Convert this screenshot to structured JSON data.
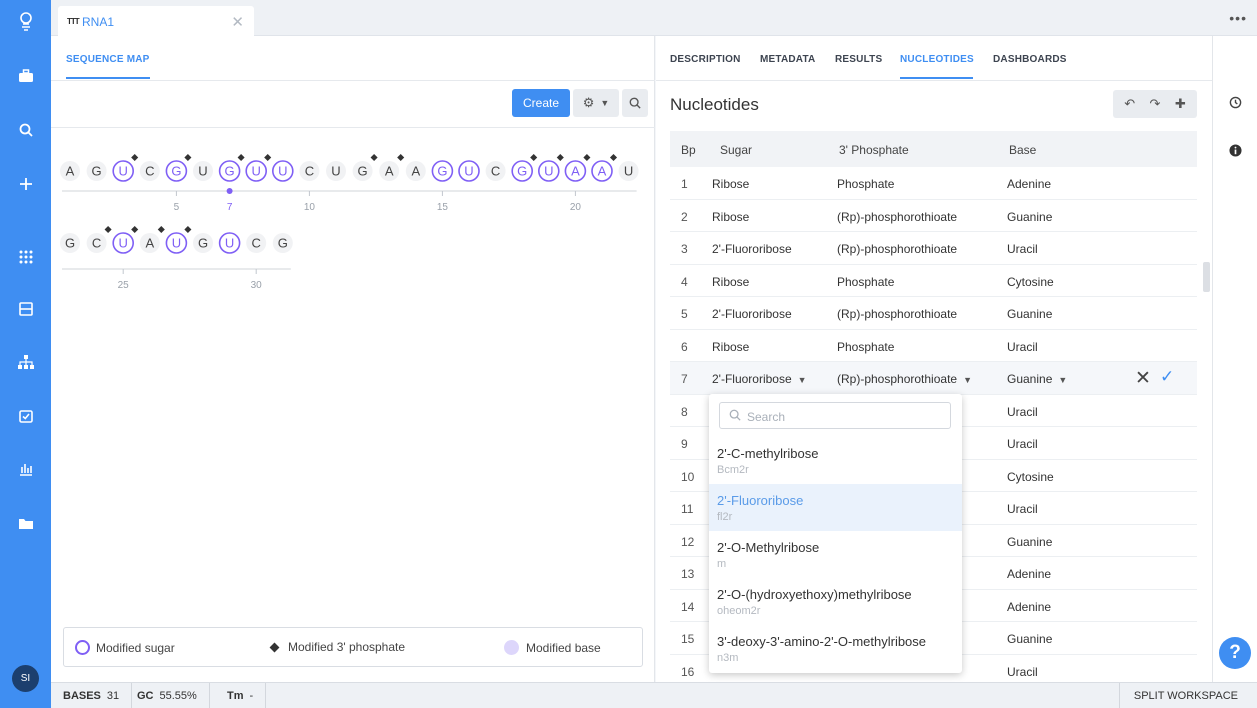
{
  "rail": {
    "avatar": "SI",
    "icons": [
      "logo-icon",
      "briefcase-icon",
      "search-icon",
      "plus-icon",
      "apps-grid-icon",
      "layout-icon",
      "hierarchy-icon",
      "task-check-icon",
      "chart-icon",
      "folder-icon"
    ]
  },
  "tab": {
    "title": "RNA1",
    "type_icon": "TTT"
  },
  "left": {
    "subnav_title": "SEQUENCE MAP",
    "create_label": "Create"
  },
  "sequence": {
    "line1": [
      "A",
      "G",
      "U",
      "C",
      "G",
      "U",
      "G",
      "U",
      "U",
      "C",
      "U",
      "G",
      "A",
      "A",
      "G",
      "U",
      "C",
      "G",
      "U",
      "A",
      "A",
      "U"
    ],
    "line2": [
      "G",
      "C",
      "U",
      "A",
      "U",
      "G",
      "U",
      "C",
      "G"
    ],
    "mod_sugar": [
      3,
      5,
      7,
      8,
      9,
      15,
      16,
      18,
      19,
      20,
      21,
      25,
      27,
      29
    ],
    "mod_phosphate": [
      3,
      5,
      7,
      8,
      12,
      13,
      18,
      19,
      20,
      21,
      24,
      25,
      26,
      27
    ],
    "ticks1": [
      "5",
      "7",
      "10",
      "15",
      "20"
    ],
    "ticks2": [
      "25",
      "30"
    ],
    "selected": 7
  },
  "legend": {
    "sugar": "Modified sugar",
    "phosphate": "Modified 3' phosphate",
    "base": "Modified base"
  },
  "right": {
    "tabs": [
      "DESCRIPTION",
      "METADATA",
      "RESULTS",
      "NUCLEOTIDES",
      "DASHBOARDS"
    ],
    "active_tab": "NUCLEOTIDES",
    "title": "Nucleotides"
  },
  "table": {
    "headers": [
      "Bp",
      "Sugar",
      "3' Phosphate",
      "Base"
    ],
    "rows": [
      {
        "bp": "1",
        "sugar": "Ribose",
        "phosphate": "Phosphate",
        "base": "Adenine"
      },
      {
        "bp": "2",
        "sugar": "Ribose",
        "phosphate": "(Rp)-phosphorothioate",
        "base": "Guanine"
      },
      {
        "bp": "3",
        "sugar": "2'-Fluororibose",
        "phosphate": "(Rp)-phosphorothioate",
        "base": "Uracil"
      },
      {
        "bp": "4",
        "sugar": "Ribose",
        "phosphate": "Phosphate",
        "base": "Cytosine"
      },
      {
        "bp": "5",
        "sugar": "2'-Fluororibose",
        "phosphate": "(Rp)-phosphorothioate",
        "base": "Guanine"
      },
      {
        "bp": "6",
        "sugar": "Ribose",
        "phosphate": "Phosphate",
        "base": "Uracil"
      },
      {
        "bp": "7",
        "sugar": "2'-Fluororibose",
        "phosphate": "(Rp)-phosphorothioate",
        "base": "Guanine"
      },
      {
        "bp": "8",
        "sugar": "",
        "phosphate": "",
        "base": "Uracil"
      },
      {
        "bp": "9",
        "sugar": "",
        "phosphate": "",
        "base": "Uracil"
      },
      {
        "bp": "10",
        "sugar": "",
        "phosphate": "",
        "base": "Cytosine"
      },
      {
        "bp": "11",
        "sugar": "",
        "phosphate": "",
        "base": "Uracil"
      },
      {
        "bp": "12",
        "sugar": "",
        "phosphate": "",
        "base": "Guanine"
      },
      {
        "bp": "13",
        "sugar": "",
        "phosphate": "",
        "base": "Adenine"
      },
      {
        "bp": "14",
        "sugar": "",
        "phosphate": "",
        "base": "Adenine"
      },
      {
        "bp": "15",
        "sugar": "",
        "phosphate": "",
        "base": "Guanine"
      },
      {
        "bp": "16",
        "sugar": "",
        "phosphate": "",
        "base": "Uracil"
      }
    ]
  },
  "dropdown": {
    "placeholder": "Search",
    "options": [
      {
        "name": "2'-C-methylribose",
        "code": "Bcm2r"
      },
      {
        "name": "2'-Fluororibose",
        "code": "fl2r",
        "selected": true
      },
      {
        "name": "2'-O-Methylribose",
        "code": "m"
      },
      {
        "name": "2'-O-(hydroxyethoxy)methylribose",
        "code": "oheom2r"
      },
      {
        "name": "3'-deoxy-3'-amino-2'-O-methylribose",
        "code": "n3m"
      }
    ]
  },
  "status": {
    "bases_label": "BASES",
    "bases": "31",
    "gc_label": "GC",
    "gc": "55.55%",
    "tm_label": "Tm",
    "tm": "-",
    "split": "SPLIT WORKSPACE"
  },
  "colors": {
    "accent": "#3f8ef2",
    "modification": "#7f5ff5",
    "mod_base_fill": "#ddd6fb"
  }
}
